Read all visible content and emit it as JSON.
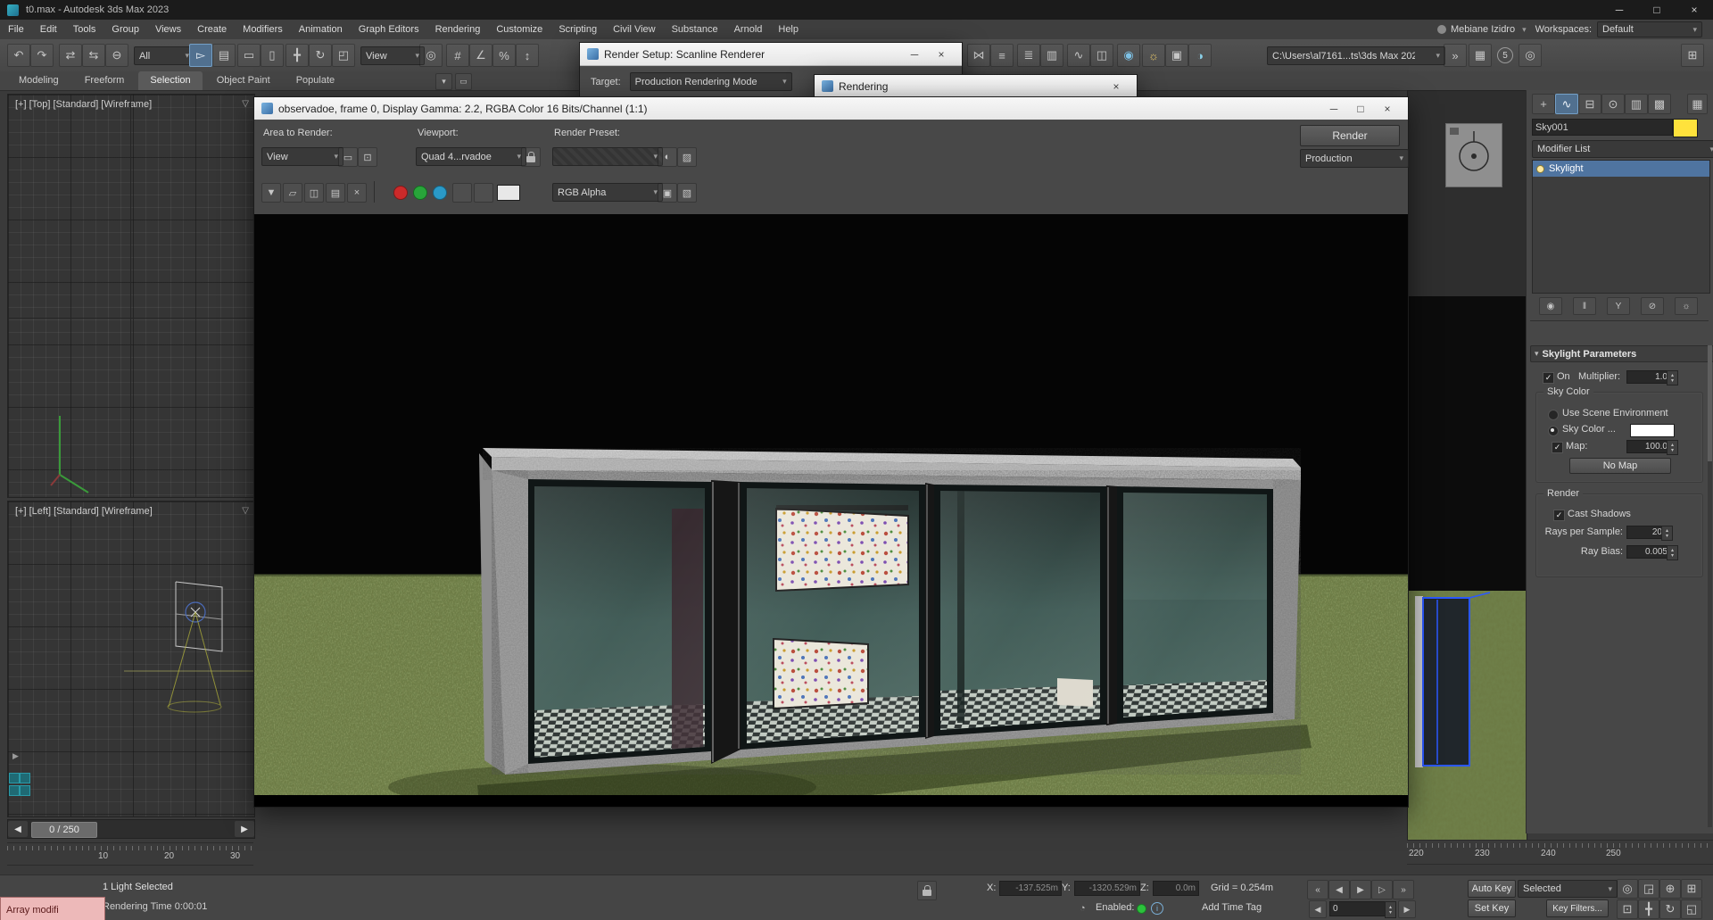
{
  "app": {
    "title": "t0.max - Autodesk 3ds Max 2023"
  },
  "menu": {
    "items": [
      "File",
      "Edit",
      "Tools",
      "Group",
      "Views",
      "Create",
      "Modifiers",
      "Animation",
      "Graph Editors",
      "Rendering",
      "Customize",
      "Scripting",
      "Civil View",
      "Substance",
      "Arnold",
      "Help"
    ],
    "user": "Mebiane Izidro",
    "workspaces_label": "Workspaces:",
    "workspace": "Default"
  },
  "toolbar": {
    "selection_filter": "All",
    "ref_coord": "View",
    "project_path": "C:\\Users\\al7161...ts\\3ds Max 202",
    "badge": "5"
  },
  "ribbon": {
    "tabs": [
      "Modeling",
      "Freeform",
      "Selection",
      "Object Paint",
      "Populate"
    ]
  },
  "viewports": {
    "top_label": "[+] [Top] [Standard] [Wireframe]",
    "left_label": "[+] [Left] [Standard] [Wireframe]"
  },
  "render_setup": {
    "title": "Render Setup: Scanline Renderer",
    "target_label": "Target:",
    "target_value": "Production Rendering Mode"
  },
  "rendering_dialog": {
    "title": "Rendering"
  },
  "rfw": {
    "title": "observadoe, frame 0, Display Gamma: 2.2, RGBA Color 16 Bits/Channel (1:1)",
    "area_label": "Area to Render:",
    "area_value": "View",
    "viewport_label": "Viewport:",
    "viewport_value": "Quad 4...rvadoe",
    "preset_label": "Render Preset:",
    "channel_value": "RGB Alpha",
    "render_button": "Render",
    "mode_value": "Production"
  },
  "cmd": {
    "object_name": "Sky001",
    "modifier_list": "Modifier List",
    "stack": [
      "Skylight"
    ],
    "rollout": "Skylight Parameters",
    "on_label": "On",
    "multiplier_label": "Multiplier:",
    "multiplier": "1.0",
    "sky_group": "Sky Color",
    "use_scene_env": "Use Scene Environment",
    "sky_color_label": "Sky Color ...",
    "map_label": "Map:",
    "map_value": "100.0",
    "no_map": "No Map",
    "render_group": "Render",
    "cast_shadows": "Cast Shadows",
    "rays_label": "Rays per Sample:",
    "rays": "20",
    "bias_label": "Ray Bias:",
    "bias": "0.005"
  },
  "timeline": {
    "slider": "0 / 250",
    "left_ticks": [
      "10",
      "20",
      "30"
    ],
    "right_ticks": [
      "220",
      "230",
      "240",
      "250"
    ]
  },
  "status": {
    "selection": "1 Light Selected",
    "render_time": "Rendering Time 0:00:01",
    "listener": "Array modifi",
    "x_label": "X:",
    "x": "-137.525m",
    "y_label": "Y:",
    "y": "-1320.529m",
    "z_label": "Z:",
    "z": "0.0m",
    "grid": "Grid = 0.254m",
    "enabled_label": "Enabled:",
    "add_time_tag": "Add Time Tag",
    "auto_key": "Auto Key",
    "selected": "Selected",
    "set_key": "Set Key",
    "key_filters": "Key Filters...",
    "frame": "0"
  },
  "colors": {
    "stack_highlight": "#4f74a0",
    "light_swatch": "#ffe23c",
    "sky_color_swatch": "#ffffff",
    "grass": "#6b7842",
    "render_bg": "#050505",
    "selection_blue": "#2b58ff",
    "listener_pink": "#edb9b9"
  },
  "icons": {
    "undo": "↶",
    "redo": "↷",
    "link": "⇄",
    "unlink": "⇆",
    "bind": "⊖",
    "select": "▻",
    "byname": "▤",
    "region": "▭",
    "crossing": "▯",
    "move": "╋",
    "rotate": "↻",
    "scale": "◰",
    "usecenter": "◎",
    "snap3": "#",
    "snapang": "∠",
    "snappct": "%",
    "snapspin": "↕",
    "mirror": "⋈",
    "align": "≡",
    "layers": "≣",
    "ribbontg": "▥",
    "curve": "∿",
    "schematic": "◫",
    "material": "◉",
    "rendersetup": "☼",
    "rfwicon": "▣",
    "renderprod": "◑",
    "chevrons": "»",
    "gridico": "▦",
    "extra": "⊞",
    "dd": "▾",
    "min": "─",
    "max": "□",
    "close": "×",
    "save": "▼",
    "copy": "▱",
    "clone": "◫",
    "print": "▤",
    "xclose": "×",
    "sphere": "◐",
    "gradient": "▨",
    "swsave": "▣",
    "gamma": "▧",
    "create": "+",
    "modify": "∿",
    "hierarchy": "⊟",
    "motion": "⊙",
    "display": "▥",
    "utilities": "▩",
    "panelcfg": "▦",
    "pin": "◉",
    "endresult": "‖",
    "unique": "Y",
    "removemod": "⊘",
    "configsets": "☼",
    "check": "✓",
    "degrade": "▽",
    "flyout": "▶",
    "tstart": "«",
    "tprev": "◀",
    "tplay": "▶",
    "tnext": "▷",
    "tend": "»",
    "fprev": "◀",
    "fnext": "▶",
    "clock": "◔",
    "info": "i",
    "isolate": "◎",
    "offsets": "◲",
    "zoom": "⊕",
    "zoomall": "⊞",
    "zoomext": "⊡",
    "pan": "╋",
    "orbit": "↻",
    "maxvp": "◱",
    "subregion": "▭",
    "subregion2": "⊡"
  }
}
